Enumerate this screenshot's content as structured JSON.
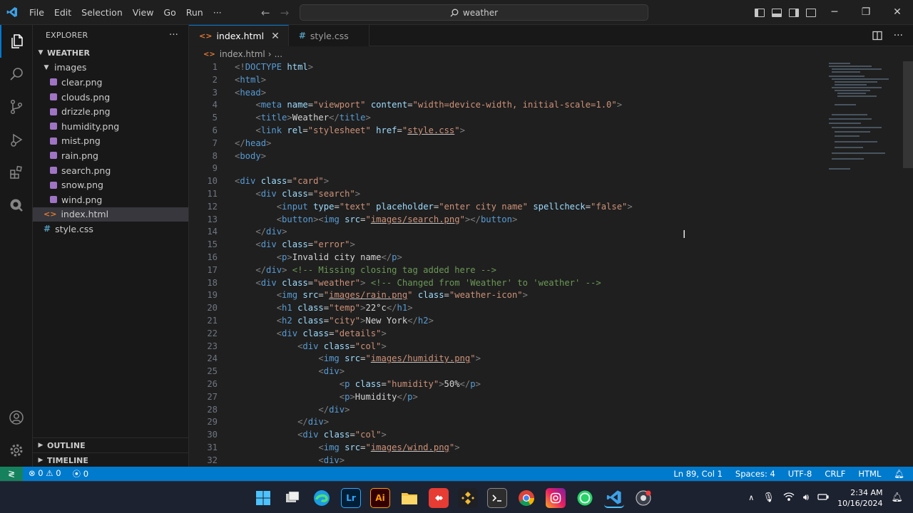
{
  "menu": [
    "File",
    "Edit",
    "Selection",
    "View",
    "Go",
    "Run",
    "···"
  ],
  "search": {
    "text": "weather"
  },
  "explorer": {
    "title": "EXPLORER",
    "more": "···",
    "root": "WEATHER",
    "folder": "images",
    "images": [
      "clear.png",
      "clouds.png",
      "drizzle.png",
      "humidity.png",
      "mist.png",
      "rain.png",
      "search.png",
      "snow.png",
      "wind.png"
    ],
    "files": [
      "index.html",
      "style.css"
    ],
    "outline": "OUTLINE",
    "timeline": "TIMELINE"
  },
  "tabs": [
    {
      "label": "index.html",
      "close": "✕"
    },
    {
      "label": "style.css"
    }
  ],
  "breadcrumb": {
    "file": "index.html",
    "sep": "›",
    "more": "..."
  },
  "code": {
    "line_numbers": [
      "1",
      "2",
      "3",
      "4",
      "5",
      "6",
      "7",
      "8",
      "9",
      "10",
      "11",
      "12",
      "13",
      "14",
      "15",
      "16",
      "17",
      "18",
      "19",
      "20",
      "21",
      "22",
      "23",
      "24",
      "25",
      "26",
      "27",
      "28",
      "29",
      "30",
      "31",
      "32"
    ]
  },
  "status": {
    "errors": "0",
    "warnings": "0",
    "ports": "0",
    "position": "Ln 89, Col 1",
    "spaces": "Spaces: 4",
    "encoding": "UTF-8",
    "eol": "CRLF",
    "language": "HTML"
  },
  "taskbar": {
    "time": "2:34 AM",
    "date": "10/16/2024"
  },
  "colors": {
    "accent": "#0078d4",
    "statusbar": "#007acc",
    "remote": "#16825d"
  }
}
